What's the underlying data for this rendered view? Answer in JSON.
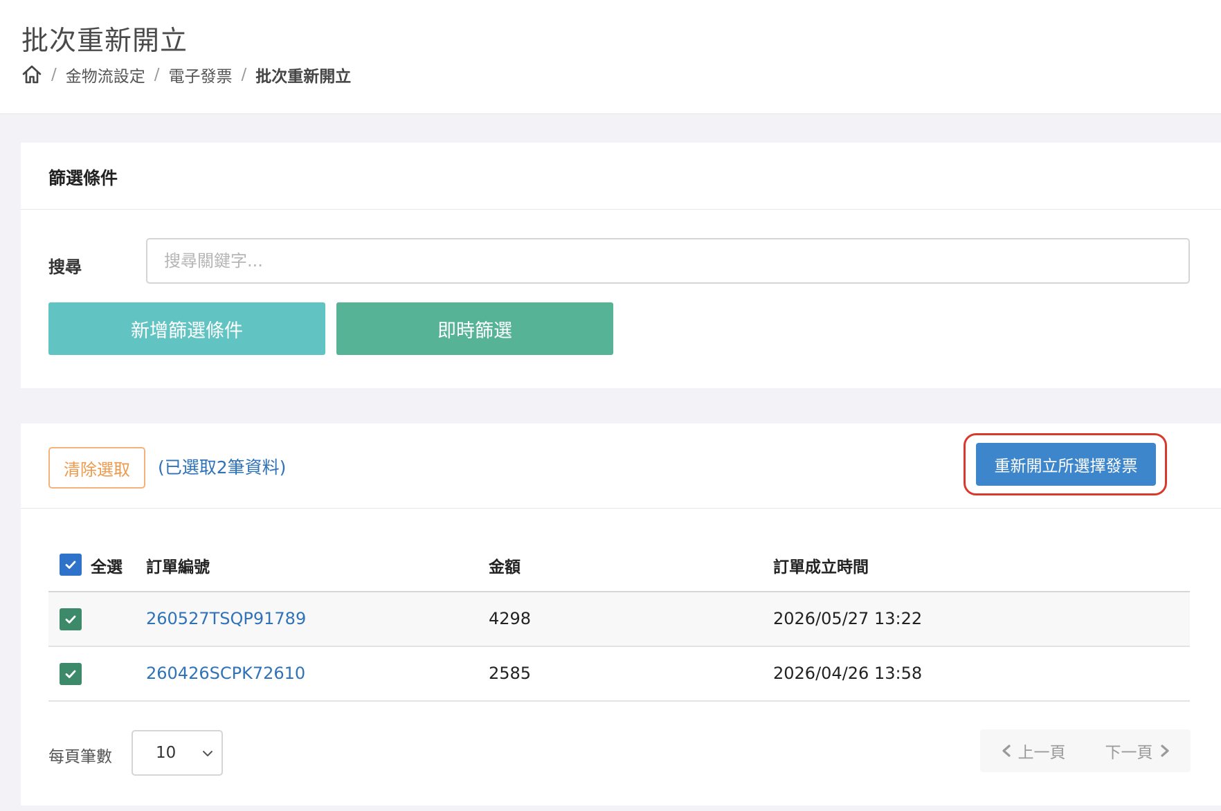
{
  "header": {
    "title": "批次重新開立",
    "breadcrumb": [
      "金物流設定",
      "電子發票",
      "批次重新開立"
    ],
    "separator": "/"
  },
  "filter": {
    "title": "篩選條件",
    "search_label": "搜尋",
    "search_placeholder": "搜尋關鍵字...",
    "search_value": "",
    "add_filter_label": "新增篩選條件",
    "live_filter_label": "即時篩選"
  },
  "list": {
    "clear_selection_label": "清除選取",
    "selected_count_text": "(已選取2筆資料)",
    "reissue_label": "重新開立所選擇發票",
    "select_all_label": "全選",
    "columns": [
      "訂單編號",
      "金額",
      "訂單成立時間"
    ],
    "rows": [
      {
        "order_no": "260527TSQP91789",
        "amount": "4298",
        "created_at": "2026/05/27 13:22",
        "checked": true
      },
      {
        "order_no": "260426SCPK72610",
        "amount": "2585",
        "created_at": "2026/04/26 13:58",
        "checked": true
      }
    ],
    "per_page_label": "每頁筆數",
    "per_page_value": "10",
    "prev_label": "上一頁",
    "next_label": "下一頁"
  },
  "colors": {
    "add_filter": "#62c3c3",
    "live_filter": "#56b396",
    "reissue": "#3d86cc",
    "highlight": "#d9392c",
    "link": "#2f72b7",
    "clear_border": "#f2b27a"
  }
}
